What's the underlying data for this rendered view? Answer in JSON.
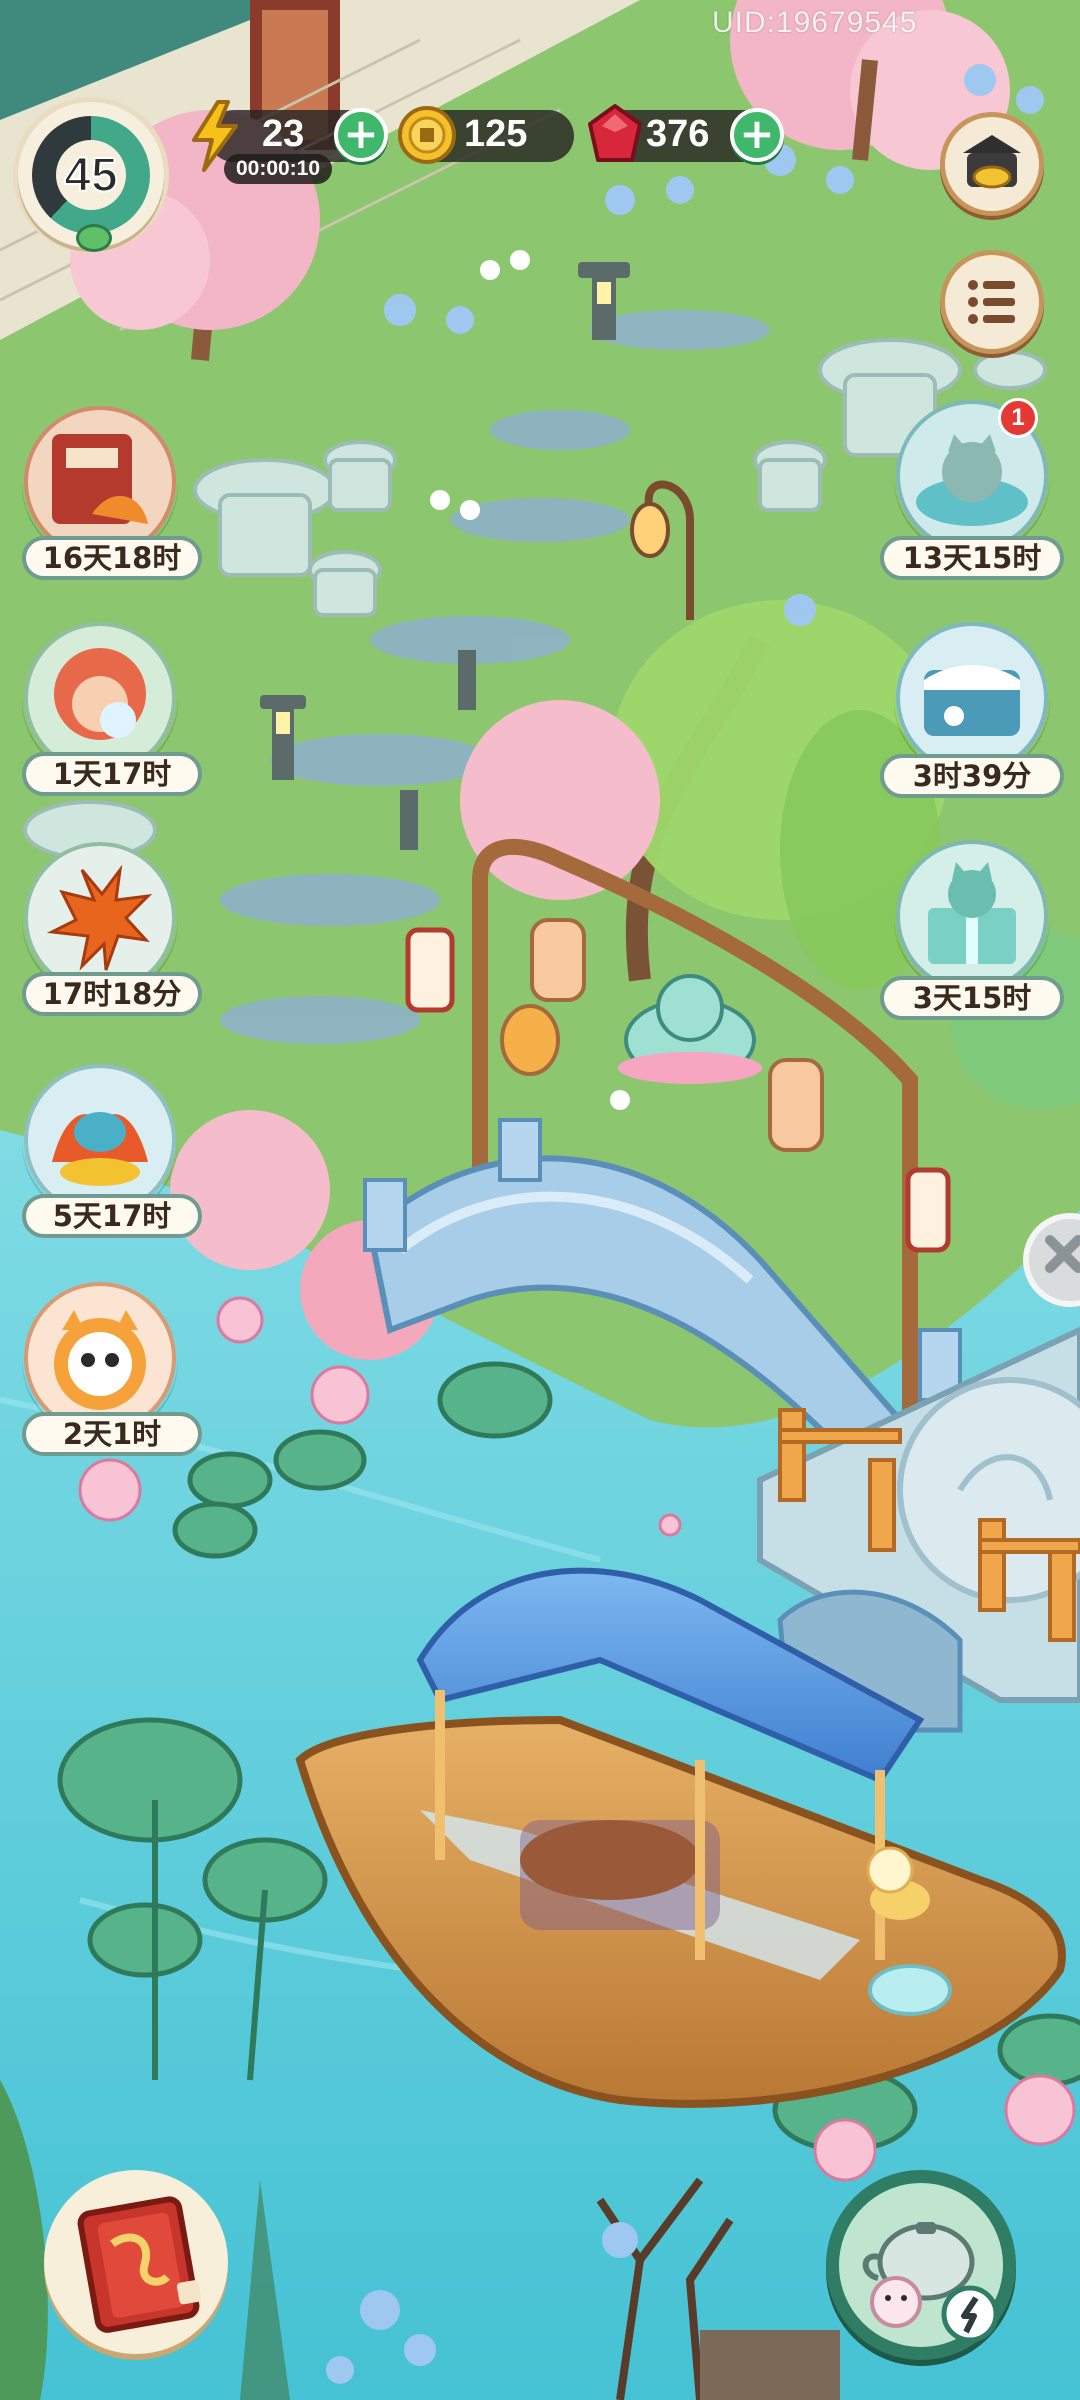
{
  "uid": "UID:19679545",
  "player": {
    "level": "45",
    "level_progress": 0.62
  },
  "currencies": {
    "energy": {
      "value": "23",
      "timer": "00:00:10",
      "icon": "lightning-icon"
    },
    "coins": {
      "value": "125",
      "icon": "coin-icon"
    },
    "gems": {
      "value": "376",
      "icon": "red-gem-icon"
    }
  },
  "events_left": [
    {
      "time": "16天18时",
      "icon": "lantern-scroll-event-icon"
    },
    {
      "time": "1天17时",
      "icon": "lion-dance-event-icon"
    },
    {
      "time": "17时18分",
      "icon": "maple-leaf-event-icon"
    },
    {
      "time": "5天17时",
      "icon": "autumn-festival-event-icon"
    },
    {
      "time": "2天1时",
      "icon": "lucky-cat-event-icon"
    }
  ],
  "events_right": [
    {
      "time": "13天15时",
      "icon": "hot-spring-cat-event-icon",
      "badge": "1"
    },
    {
      "time": "3时39分",
      "icon": "winter-scene-event-icon"
    },
    {
      "time": "3天15时",
      "icon": "gift-box-cat-event-icon"
    }
  ],
  "colors": {
    "water": "#5fd0dc",
    "grass": "#8cc66e",
    "accent_green": "#3fb86c",
    "gem_red": "#d6283a"
  }
}
